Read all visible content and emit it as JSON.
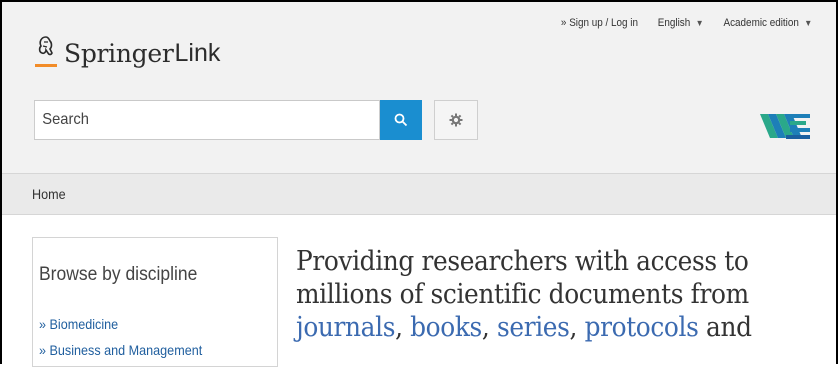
{
  "brand": {
    "springer": "Springer",
    "link": "Link"
  },
  "topnav": {
    "signup": "» Sign up / Log in",
    "language": "English",
    "edition": "Academic edition"
  },
  "search": {
    "placeholder": "Search"
  },
  "breadcrumb": {
    "home": "Home"
  },
  "sidebar": {
    "title": "Browse by discipline",
    "items": [
      {
        "label": "» Biomedicine"
      },
      {
        "label": "» Business and Management"
      }
    ]
  },
  "hero": {
    "line1": "Providing researchers with access to",
    "line2": "millions of scientific documents from",
    "links": {
      "journals": "journals",
      "books": "books",
      "series": "series",
      "protocols": "protocols"
    },
    "sep": ", ",
    "and": " and"
  },
  "icons": {
    "search": "search-icon",
    "settings": "gear-icon",
    "horse": "springer-horse-icon",
    "partner": "partner-logo"
  },
  "colors": {
    "accent": "#1a8ed0",
    "link": "#3b6ab0",
    "sidebar_link": "#1f5e9e"
  }
}
